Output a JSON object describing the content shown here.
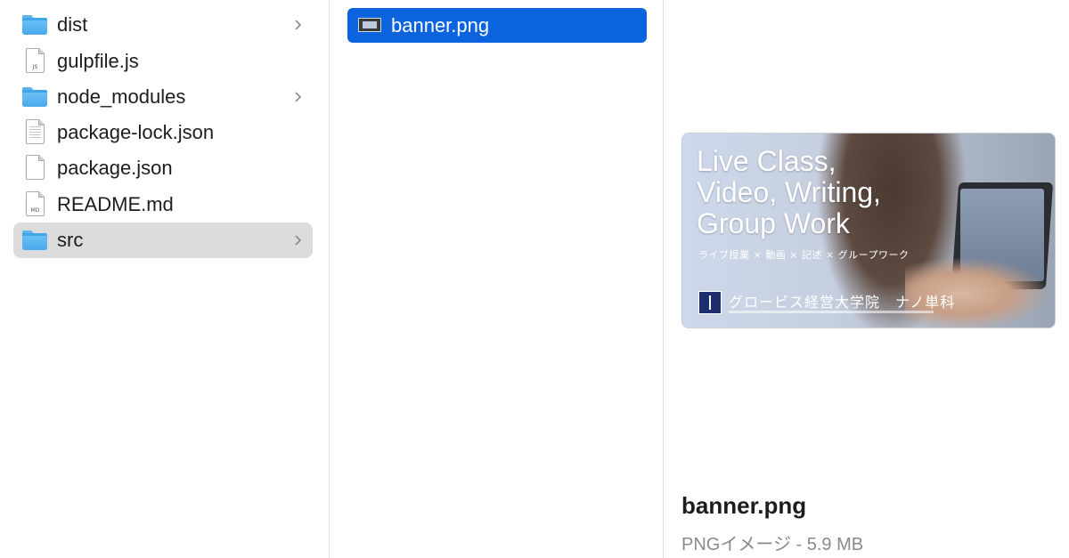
{
  "sidebar": {
    "items": [
      {
        "label": "dist",
        "type": "folder",
        "icon": "folder-icon",
        "has_children": true
      },
      {
        "label": "gulpfile.js",
        "type": "file",
        "icon": "js-file-icon",
        "tag": "JS"
      },
      {
        "label": "node_modules",
        "type": "folder",
        "icon": "folder-icon",
        "has_children": true
      },
      {
        "label": "package-lock.json",
        "type": "file",
        "icon": "text-file-icon"
      },
      {
        "label": "package.json",
        "type": "file",
        "icon": "text-file-icon"
      },
      {
        "label": "README.md",
        "type": "file",
        "icon": "md-file-icon",
        "tag": "MD"
      },
      {
        "label": "src",
        "type": "folder",
        "icon": "folder-icon",
        "has_children": true,
        "selected": true
      }
    ]
  },
  "column2": {
    "selected_file": {
      "label": "banner.png",
      "icon": "image-file-icon"
    }
  },
  "preview": {
    "headline": "Live Class,\nVideo, Writing,\nGroup Work",
    "tagline": "ライブ授業 × 動画 × 記述 × グループワーク",
    "school": "グロービス経営大学院　ナノ単科",
    "file_name": "banner.png",
    "file_kind": "PNGイメージ - 5.9 MB"
  },
  "colors": {
    "selection_blue": "#0b63de",
    "selection_gray": "#dcdcdc",
    "folder_blue": "#48a9ec"
  }
}
